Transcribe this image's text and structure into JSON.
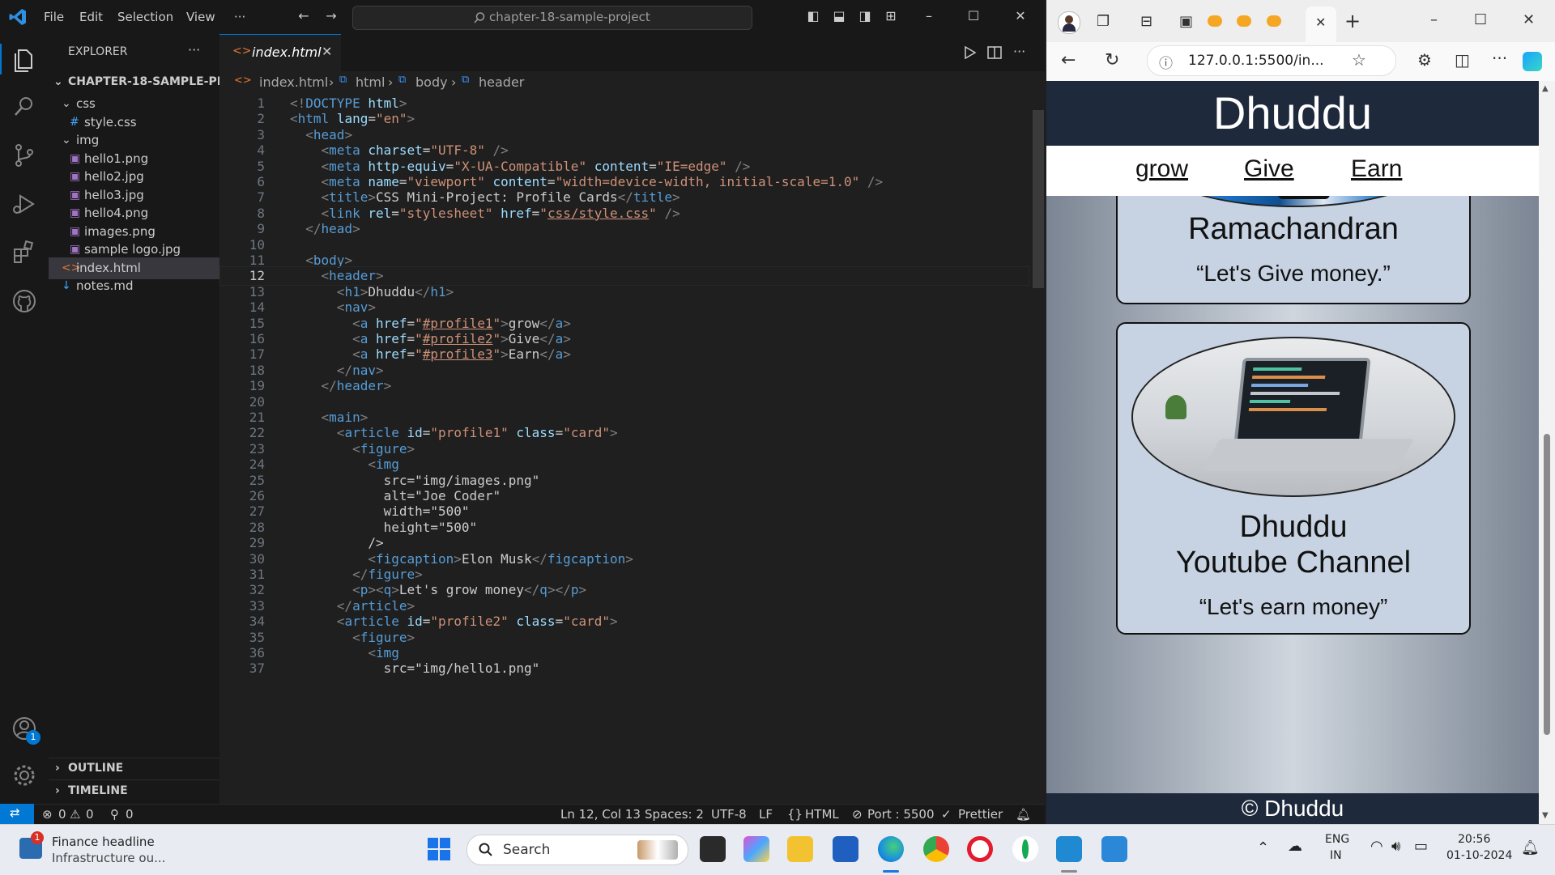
{
  "vscode": {
    "menu": [
      "File",
      "Edit",
      "Selection",
      "View",
      "···"
    ],
    "command_center": "chapter-18-sample-project",
    "explorer_title": "EXPLORER",
    "explorer_more": "···",
    "project_name": "CHAPTER-18-SAMPLE-PR...",
    "tree": [
      {
        "label": "css",
        "type": "folder",
        "depth": 1
      },
      {
        "label": "style.css",
        "type": "css",
        "depth": 2
      },
      {
        "label": "img",
        "type": "folder",
        "depth": 1
      },
      {
        "label": "hello1.png",
        "type": "image",
        "depth": 2
      },
      {
        "label": "hello2.jpg",
        "type": "image",
        "depth": 2
      },
      {
        "label": "hello3.jpg",
        "type": "image",
        "depth": 2
      },
      {
        "label": "hello4.png",
        "type": "image",
        "depth": 2
      },
      {
        "label": "images.png",
        "type": "image",
        "depth": 2
      },
      {
        "label": "sample logo.jpg",
        "type": "image",
        "depth": 2
      },
      {
        "label": "index.html",
        "type": "html",
        "depth": 1,
        "selected": true
      },
      {
        "label": "notes.md",
        "type": "md",
        "depth": 1
      }
    ],
    "outline": "OUTLINE",
    "timeline": "TIMELINE",
    "accounts_badge": "1",
    "tab_label": "index.html",
    "breadcrumb": [
      "index.html",
      "html",
      "body",
      "header"
    ],
    "current_line": 12,
    "code_lines": [
      "<!DOCTYPE html>",
      "<html lang=\"en\">",
      "  <head>",
      "    <meta charset=\"UTF-8\" />",
      "    <meta http-equiv=\"X-UA-Compatible\" content=\"IE=edge\" />",
      "    <meta name=\"viewport\" content=\"width=device-width, initial-scale=1.0\" />",
      "    <title>CSS Mini-Project: Profile Cards</title>",
      "    <link rel=\"stylesheet\" href=\"css/style.css\" />",
      "  </head>",
      "",
      "  <body>",
      "    <header>",
      "      <h1>Dhuddu</h1>",
      "      <nav>",
      "        <a href=\"#profile1\">grow</a>",
      "        <a href=\"#profile2\">Give</a>",
      "        <a href=\"#profile3\">Earn</a>",
      "      </nav>",
      "    </header>",
      "",
      "    <main>",
      "      <article id=\"profile1\" class=\"card\">",
      "        <figure>",
      "          <img",
      "            src=\"img/images.png\"",
      "            alt=\"Joe Coder\"",
      "            width=\"500\"",
      "            height=\"500\"",
      "          />",
      "          <figcaption>Elon Musk</figcaption>",
      "        </figure>",
      "        <p><q>Let's grow money</q></p>",
      "      </article>",
      "      <article id=\"profile2\" class=\"card\">",
      "        <figure>",
      "          <img",
      "            src=\"img/hello1.png\""
    ],
    "status": {
      "errors": "0",
      "warnings": "0",
      "ports": "0",
      "position": "Ln 12, Col 13",
      "spaces": "Spaces: 2",
      "encoding": "UTF-8",
      "eol": "LF",
      "language": "HTML",
      "port": "Port : 5500",
      "prettier": "Prettier"
    }
  },
  "browser": {
    "url": "127.0.0.1:5500/in...",
    "page": {
      "h1": "Dhuddu",
      "nav": [
        "grow",
        "Give",
        "Earn"
      ],
      "card1_name": "Ramachandran",
      "card1_quote": "“Let's Give money.”",
      "card2_name_line1": "Dhuddu",
      "card2_name_line2": "Youtube Channel",
      "card2_quote": "“Let's earn money”",
      "footer": "© Dhuddu"
    }
  },
  "taskbar": {
    "news_title": "Finance headline",
    "news_subtitle": "Infrastructure ou...",
    "news_badge": "1",
    "search_placeholder": "Search",
    "lang_line1": "ENG",
    "lang_line2": "IN",
    "time": "20:56",
    "date": "01-10-2024"
  }
}
